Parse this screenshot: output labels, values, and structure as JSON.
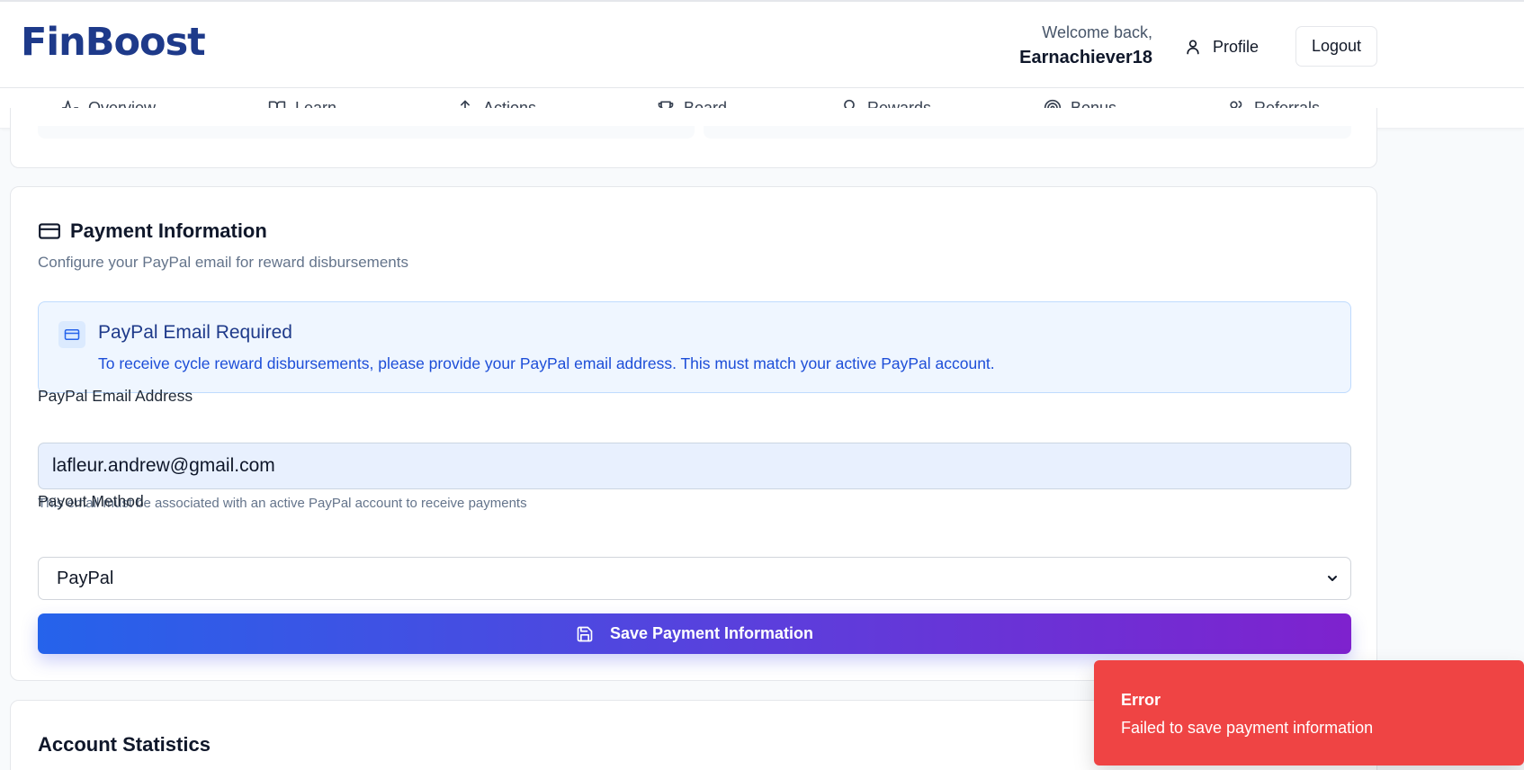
{
  "brand": {
    "logo_text": "FinBoost",
    "color": "#1e3a8a"
  },
  "header": {
    "welcome_label": "Welcome back,",
    "username": "Earnachiever18",
    "profile_label": "Profile",
    "logout_label": "Logout"
  },
  "nav": {
    "items": [
      {
        "label": "Overview",
        "icon": "activity-icon"
      },
      {
        "label": "Learn",
        "icon": "book-open-icon"
      },
      {
        "label": "Actions",
        "icon": "upload-icon"
      },
      {
        "label": "Board",
        "icon": "trophy-icon"
      },
      {
        "label": "Rewards",
        "icon": "award-icon"
      },
      {
        "label": "Bonus",
        "icon": "target-icon"
      },
      {
        "label": "Referrals",
        "icon": "users-icon"
      }
    ]
  },
  "payment": {
    "title": "Payment Information",
    "description": "Configure your PayPal email for reward disbursements",
    "alert": {
      "title": "PayPal Email Required",
      "text": "To receive cycle reward disbursements, please provide your PayPal email address. This must match your active PayPal account."
    },
    "email_label": "PayPal Email Address",
    "email_value": "lafleur.andrew@gmail.com",
    "email_hint": "This email must be associated with an active PayPal account to receive payments",
    "payout_label": "Payout Method",
    "payout_selected": "PayPal",
    "save_label": "Save Payment Information"
  },
  "stats": {
    "title": "Account Statistics"
  },
  "toast": {
    "title": "Error",
    "message": "Failed to save payment information",
    "color": "#ef4444"
  },
  "colors": {
    "accent_start": "#2563eb",
    "accent_end": "#7e22ce",
    "alert_bg": "#eff6ff"
  }
}
